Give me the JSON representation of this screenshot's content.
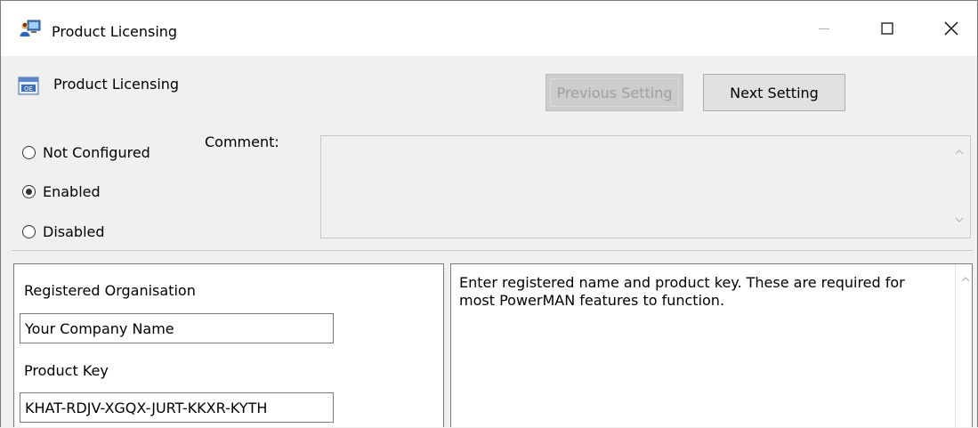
{
  "window": {
    "title": "Product Licensing",
    "app_icon": "computer-users-icon",
    "caption_buttons": [
      "minimize-icon",
      "maximize-icon",
      "close-icon"
    ]
  },
  "header": {
    "policy_icon": "policy-setting-icon",
    "policy_title": "Product Licensing",
    "previous_label": "Previous Setting",
    "next_label": "Next Setting"
  },
  "state": {
    "options": [
      {
        "label": "Not Configured",
        "checked": false
      },
      {
        "label": "Enabled",
        "checked": true
      },
      {
        "label": "Disabled",
        "checked": false
      }
    ],
    "comment_label": "Comment:",
    "comment_value": ""
  },
  "options_panel": {
    "org_label": "Registered Organisation",
    "org_value": "Your Company Name",
    "key_label": "Product Key",
    "key_value": "KHAT-RDJV-XGQX-JURT-KKXR-KYTH"
  },
  "help_panel": {
    "text": "Enter registered name and product key. These are required for most PowerMAN features to function."
  },
  "colors": {
    "window_bg": "#f0f0f0",
    "titlebar_bg": "#ffffff",
    "button_bg": "#e1e1e1",
    "disabled_text": "#a0a0a0"
  }
}
